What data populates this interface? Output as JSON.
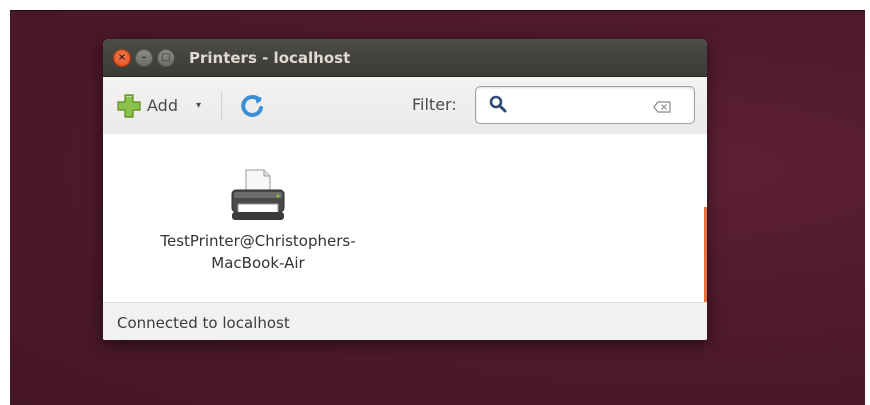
{
  "window": {
    "title": "Printers - localhost",
    "controls": {
      "close": "×",
      "minimize": "–",
      "maximize": "□"
    }
  },
  "toolbar": {
    "add_label": "Add",
    "add_menu_arrow": "▾",
    "filter_label": "Filter:",
    "filter_value": "",
    "icons": [
      "add-icon",
      "refresh-icon",
      "search-icon",
      "clear-icon"
    ]
  },
  "printers": [
    {
      "name": "TestPrinter@Christophers-\nMacBook-Air"
    }
  ],
  "status": {
    "text": "Connected to localhost"
  },
  "colors": {
    "titlebar": "#3c3b37",
    "close_button": "#df4a16",
    "accent_scroll": "#e5713f",
    "desktop": "#4f1a2c"
  }
}
